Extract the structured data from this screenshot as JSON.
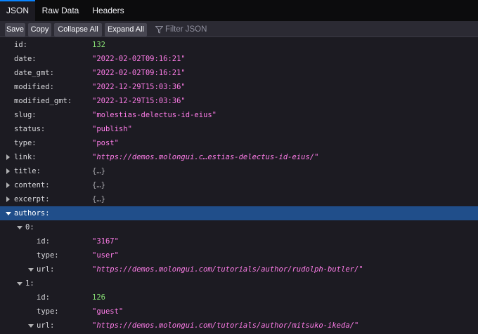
{
  "tabs": [
    "JSON",
    "Raw Data",
    "Headers"
  ],
  "toolbar": {
    "save": "Save",
    "copy": "Copy",
    "collapse_all": "Collapse All",
    "expand_all": "Expand All",
    "filter_placeholder": "Filter JSON"
  },
  "rows": [
    {
      "key": "id:",
      "value": "132",
      "type": "number"
    },
    {
      "key": "date:",
      "value": "\"2022-02-02T09:16:21\"",
      "type": "string"
    },
    {
      "key": "date_gmt:",
      "value": "\"2022-02-02T09:16:21\"",
      "type": "string"
    },
    {
      "key": "modified:",
      "value": "\"2022-12-29T15:03:36\"",
      "type": "string"
    },
    {
      "key": "modified_gmt:",
      "value": "\"2022-12-29T15:03:36\"",
      "type": "string"
    },
    {
      "key": "slug:",
      "value": "\"molestias-delectus-id-eius\"",
      "type": "string"
    },
    {
      "key": "status:",
      "value": "\"publish\"",
      "type": "string"
    },
    {
      "key": "type:",
      "value": "\"post\"",
      "type": "string"
    },
    {
      "key": "link:",
      "value": "\"https://demos.molongui.c…estias-delectus-id-eius/\"",
      "type": "link",
      "toggle": "collapsed"
    },
    {
      "key": "title:",
      "value": "{…}",
      "type": "object",
      "toggle": "collapsed"
    },
    {
      "key": "content:",
      "value": "{…}",
      "type": "object",
      "toggle": "collapsed"
    },
    {
      "key": "excerpt:",
      "value": "{…}",
      "type": "object",
      "toggle": "collapsed"
    },
    {
      "key": "authors:",
      "value": "",
      "type": "object",
      "toggle": "expanded",
      "selected": true
    },
    {
      "key": "0:",
      "value": "",
      "type": "object",
      "toggle": "expanded",
      "depth": 1
    },
    {
      "key": "id:",
      "value": "\"3167\"",
      "type": "string",
      "depth": 2
    },
    {
      "key": "type:",
      "value": "\"user\"",
      "type": "string",
      "depth": 2
    },
    {
      "key": "url:",
      "value": "\"https://demos.molongui.com/tutorials/author/rudolph-butler/\"",
      "type": "link",
      "toggle": "expanded",
      "depth": 2
    },
    {
      "key": "1:",
      "value": "",
      "type": "object",
      "toggle": "expanded",
      "depth": 1
    },
    {
      "key": "id:",
      "value": "126",
      "type": "number",
      "depth": 2
    },
    {
      "key": "type:",
      "value": "\"guest\"",
      "type": "string",
      "depth": 2
    },
    {
      "key": "url:",
      "value": "\"https://demos.molongui.com/tutorials/author/mitsuko-ikeda/\"",
      "type": "link",
      "toggle": "expanded",
      "depth": 2
    }
  ]
}
